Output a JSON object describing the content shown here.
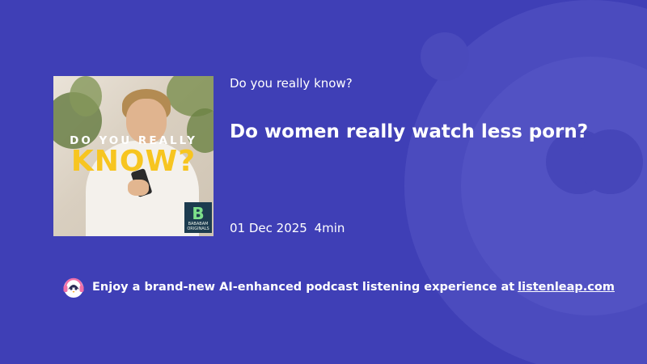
{
  "podcast": {
    "show_name": "Do you really know?",
    "cover": {
      "line1": "DO YOU REALLY",
      "line2": "KNOW?",
      "publisher_logo_letter": "B",
      "publisher_logo_text": "BABABAM ORIGINALS"
    }
  },
  "episode": {
    "title": "Do women really watch less porn?",
    "date": "01 Dec 2025",
    "duration": "4min"
  },
  "promo": {
    "icon": "penguin-headphones-icon",
    "text": "Enjoy a brand-new AI-enhanced podcast listening experience at",
    "link_text": "listenleap.com"
  },
  "colors": {
    "background": "#3f3fb6",
    "cover_title_accent": "#f7c520",
    "logo_bg": "#1d3c4f"
  }
}
